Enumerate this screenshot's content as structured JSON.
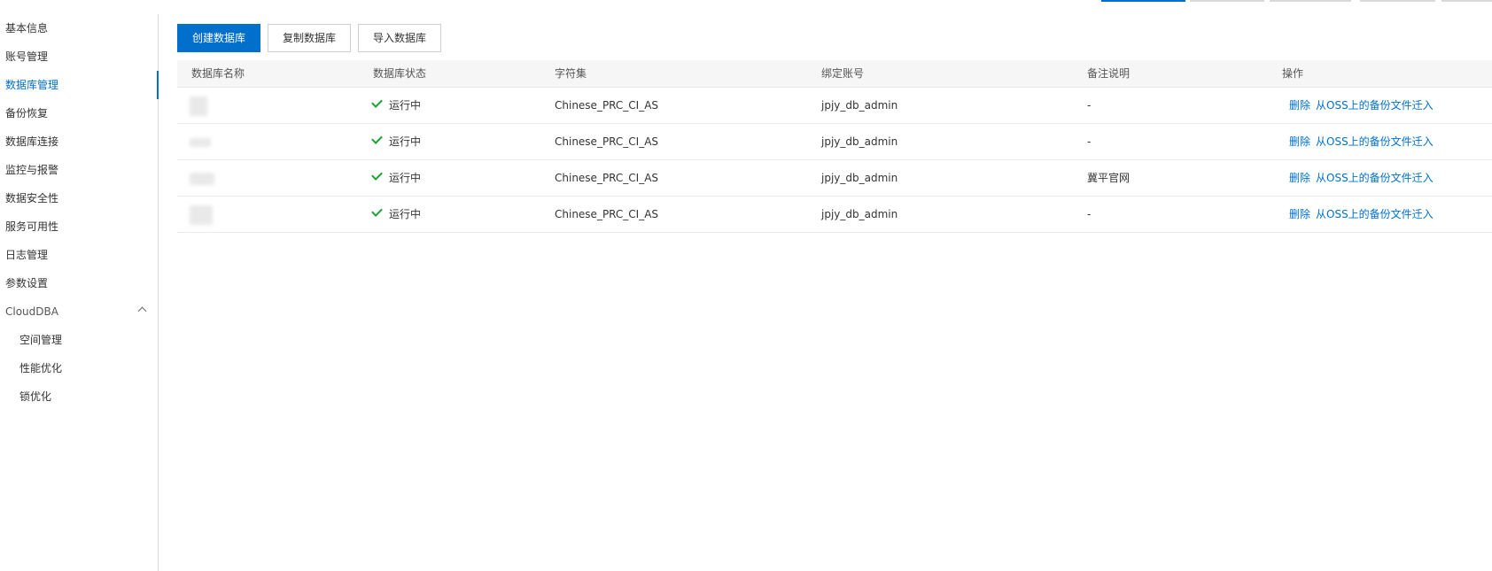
{
  "top_tabs": [
    {
      "active": true
    },
    {
      "active": false
    },
    {
      "active": false
    },
    {
      "active": false
    },
    {
      "active": false
    }
  ],
  "sidebar": {
    "items": [
      {
        "label": "基本信息"
      },
      {
        "label": "账号管理"
      },
      {
        "label": "数据库管理",
        "active": true
      },
      {
        "label": "备份恢复"
      },
      {
        "label": "数据库连接"
      },
      {
        "label": "监控与报警"
      },
      {
        "label": "数据安全性"
      },
      {
        "label": "服务可用性"
      },
      {
        "label": "日志管理"
      },
      {
        "label": "参数设置"
      }
    ],
    "group": {
      "label": "CloudDBA",
      "expanded": true,
      "children": [
        {
          "label": "空间管理"
        },
        {
          "label": "性能优化"
        },
        {
          "label": "锁优化"
        }
      ]
    }
  },
  "toolbar": {
    "create_label": "创建数据库",
    "copy_label": "复制数据库",
    "import_label": "导入数据库"
  },
  "table": {
    "columns": [
      "数据库名称",
      "数据库状态",
      "字符集",
      "绑定账号",
      "备注说明",
      "操作"
    ],
    "rows": [
      {
        "name": "",
        "status": "运行中",
        "charset": "Chinese_PRC_CI_AS",
        "account": "jpjy_db_admin",
        "remark": "-",
        "actions": [
          "删除",
          "从OSS上的备份文件迁入"
        ]
      },
      {
        "name": "",
        "status": "运行中",
        "charset": "Chinese_PRC_CI_AS",
        "account": "jpjy_db_admin",
        "remark": "-",
        "actions": [
          "删除",
          "从OSS上的备份文件迁入"
        ]
      },
      {
        "name": "",
        "status": "运行中",
        "charset": "Chinese_PRC_CI_AS",
        "account": "jpjy_db_admin",
        "remark": "冀平官网",
        "actions": [
          "删除",
          "从OSS上的备份文件迁入"
        ]
      },
      {
        "name": "",
        "status": "运行中",
        "charset": "Chinese_PRC_CI_AS",
        "account": "jpjy_db_admin",
        "remark": "-",
        "actions": [
          "删除",
          "从OSS上的备份文件迁入"
        ]
      }
    ]
  },
  "colors": {
    "accent": "#0070cc",
    "status_ok": "#1aa336"
  },
  "icons": {
    "status": "check-icon",
    "group_toggle": "chevron-up-icon"
  }
}
